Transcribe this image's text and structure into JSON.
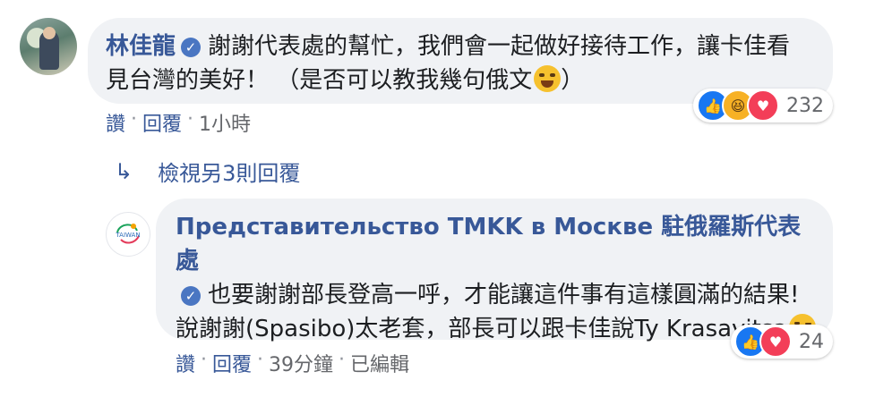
{
  "comment1": {
    "author": "林佳龍",
    "text": "謝謝代表處的幫忙，我們會一起做好接待工作，讓卡佳看見台灣的美好！ （是否可以教我幾句俄文",
    "text_end": "）",
    "emoji": "tears-of-joy-emoji",
    "actions": {
      "like": "讚",
      "reply": "回覆",
      "time": "1小時"
    },
    "reactions": {
      "count": "232",
      "icons": [
        "like",
        "haha",
        "love"
      ]
    }
  },
  "view_replies": {
    "label": "檢視另3則回覆"
  },
  "comment2": {
    "author": "Представительство TMKK в Москве 駐俄羅斯代表處",
    "text": "也要謝謝部長登高一呼，才能讓這件事有這樣圓滿的結果! 說謝謝(Spasibo)太老套，部長可以跟卡佳說Ty Krasavitsa",
    "emoji": "winking-face-emoji",
    "actions": {
      "like": "讚",
      "reply": "回覆",
      "time": "39分鐘",
      "edited": "已編輯"
    },
    "reactions": {
      "count": "24",
      "icons": [
        "like",
        "love"
      ]
    },
    "avatar_logo": "TAIWAN"
  },
  "colors": {
    "link": "#385898",
    "meta": "#65676b",
    "bubble": "#f0f2f5",
    "like": "#1877f2",
    "love": "#f33e58",
    "haha": "#f7b125"
  }
}
